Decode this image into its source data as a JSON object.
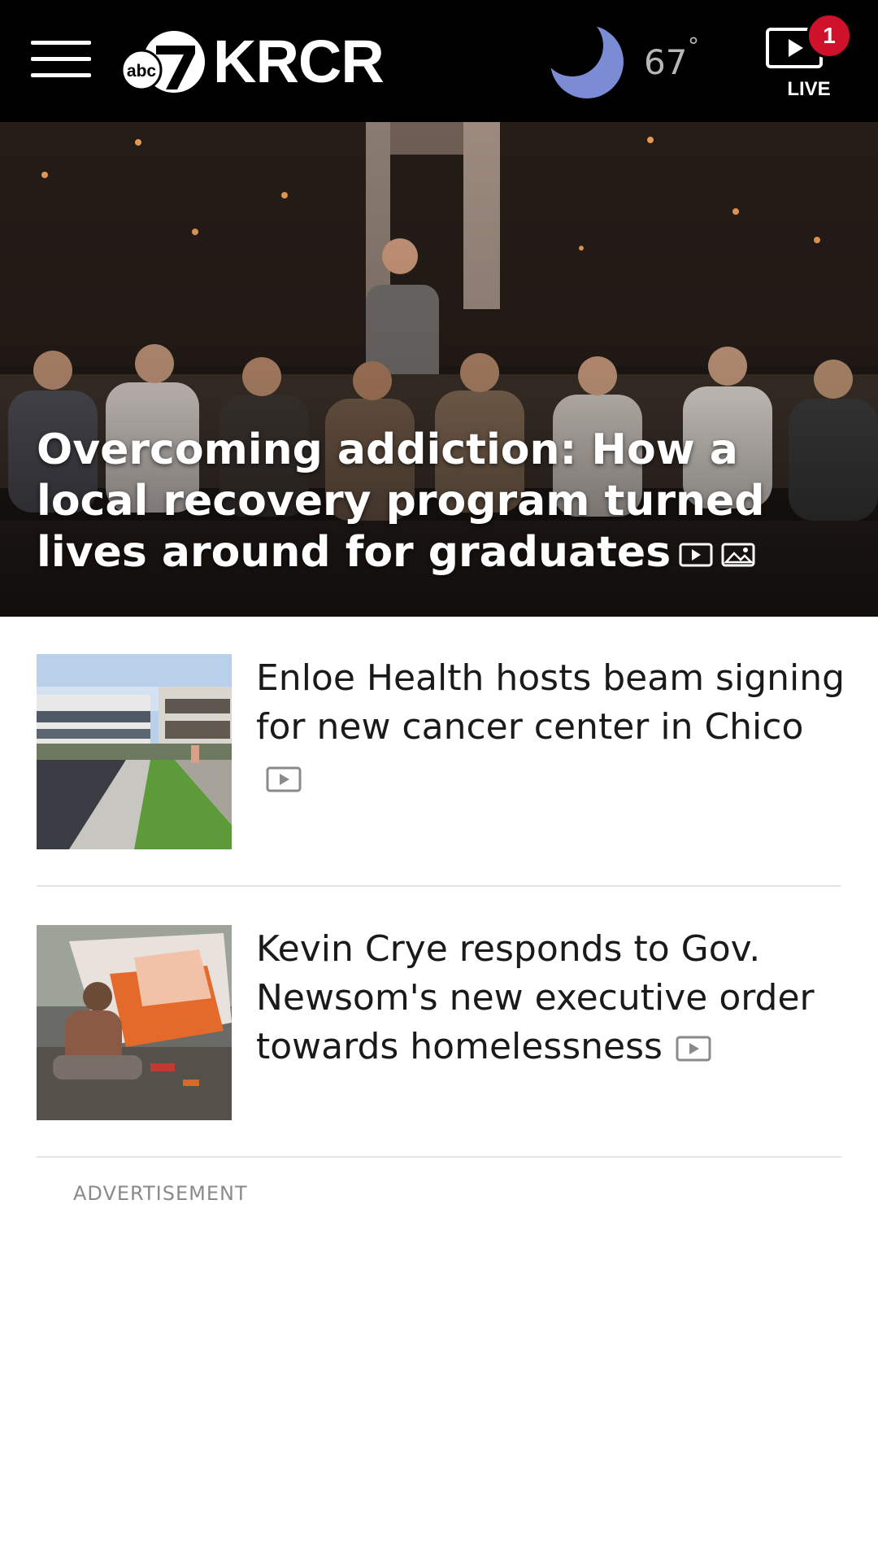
{
  "header": {
    "menu_icon": "hamburger-menu-icon",
    "logo": {
      "mark": "abc7",
      "name": "KRCR"
    },
    "weather": {
      "icon": "moon-icon",
      "temperature": "67",
      "degree_symbol": "°",
      "color": "#7b8bd4"
    },
    "live": {
      "label": "LIVE",
      "icon": "video-play-icon",
      "badge_count": "1",
      "badge_color": "#d0112b"
    }
  },
  "hero": {
    "title": "Overcoming addiction: How a local recovery program turned lives around for graduates",
    "icons": [
      "video-icon",
      "photo-gallery-icon"
    ]
  },
  "articles": [
    {
      "title": "Enloe Health hosts beam signing for new cancer center in Chico",
      "icons": [
        "video-icon"
      ]
    },
    {
      "title": "Kevin Crye responds to Gov. Newsom's new executive order towards homelessness",
      "icons": [
        "video-icon"
      ]
    }
  ],
  "advertisement": {
    "label": "ADVERTISEMENT"
  }
}
